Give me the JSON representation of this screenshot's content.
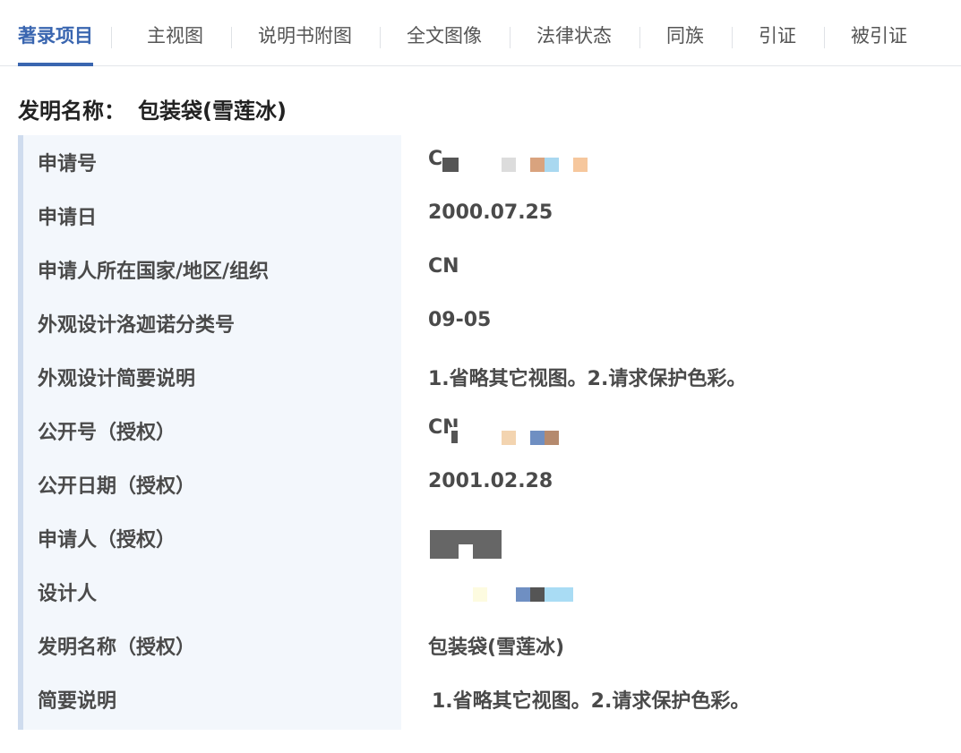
{
  "tabs": [
    {
      "label": "著录项目",
      "active": true
    },
    {
      "label": "主视图"
    },
    {
      "label": "说明书附图"
    },
    {
      "label": "全文图像"
    },
    {
      "label": "法律状态"
    },
    {
      "label": "同族"
    },
    {
      "label": "引证"
    },
    {
      "label": "被引证"
    }
  ],
  "invention": {
    "label": "发明名称：",
    "value": "包装袋(雪莲冰)"
  },
  "fields": [
    {
      "key": "申请号",
      "value": "C"
    },
    {
      "key": "申请日",
      "value": "2000.07.25"
    },
    {
      "key": "申请人所在国家/地区/组织",
      "value": "CN"
    },
    {
      "key": "外观设计洛迦诺分类号",
      "value": "09-05"
    },
    {
      "key": "外观设计简要说明",
      "value": "1.省略其它视图。2.请求保护色彩。"
    },
    {
      "key": "公开号（授权）",
      "value": "CN"
    },
    {
      "key": "公开日期（授权）",
      "value": "2001.02.28"
    },
    {
      "key": "申请人（授权）",
      "value": ""
    },
    {
      "key": "设计人",
      "value": ""
    },
    {
      "key": "发明名称（授权）",
      "value": "包装袋(雪莲冰)"
    },
    {
      "key": "简要说明",
      "value": "1.省略其它视图。2.请求保护色彩。"
    }
  ],
  "colors": {
    "accent": "#3a66b0",
    "panel_bg": "#f3f7fc",
    "panel_bar": "#cfdcee",
    "text": "#4a4a4a"
  }
}
